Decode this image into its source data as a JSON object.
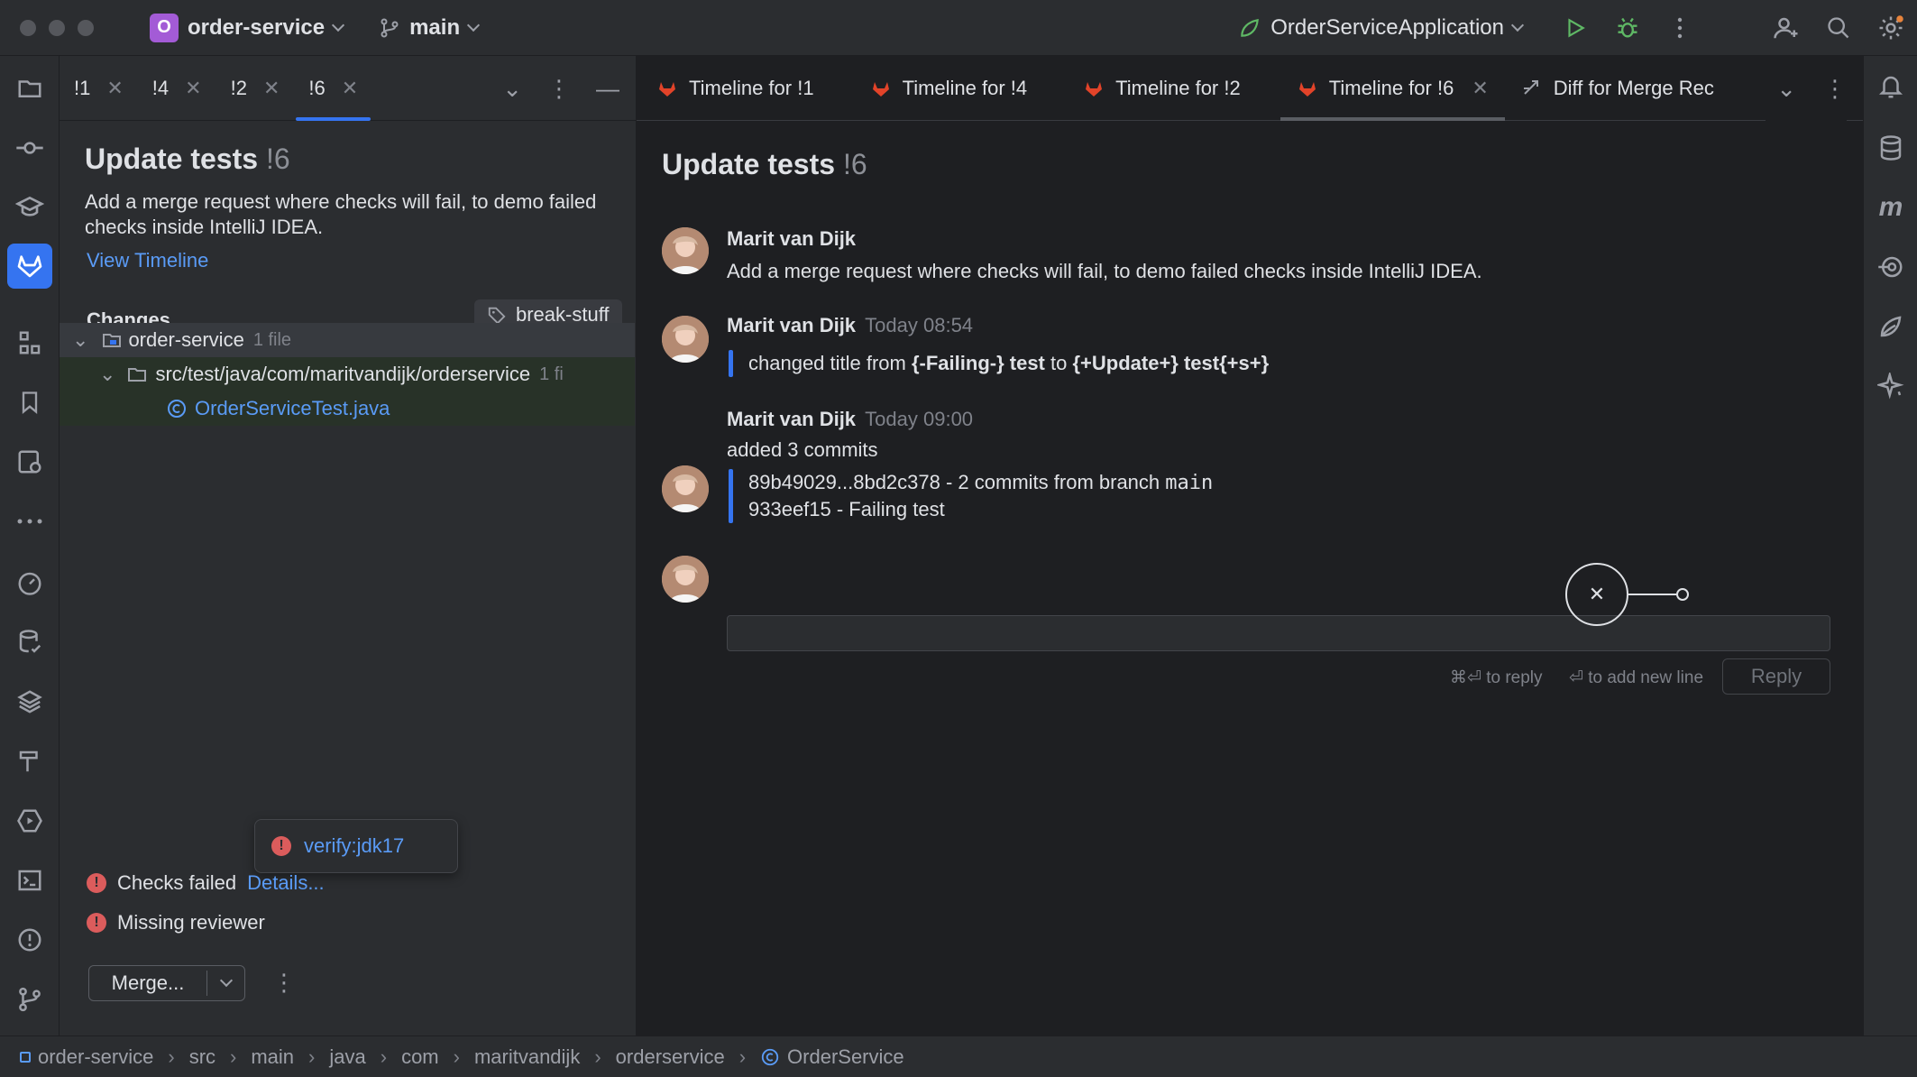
{
  "titlebar": {
    "project_badge": "O",
    "project_name": "order-service",
    "branch": "main",
    "run_config": "OrderServiceApplication"
  },
  "left_panel": {
    "tabs": [
      {
        "label": "!1"
      },
      {
        "label": "!4"
      },
      {
        "label": "!2"
      },
      {
        "label": "!6",
        "active": true
      }
    ],
    "title": "Update tests",
    "title_number": "!6",
    "description": "Add a merge request where checks will fail, to demo failed checks inside IntelliJ IDEA.",
    "view_timeline": "View Timeline",
    "changes_label": "Changes",
    "branch_tag": "break-stuff",
    "tree": {
      "root": "order-service",
      "root_count": "1 file",
      "folder": "src/test/java/com/maritvandijk/orderservice",
      "folder_count": "1 fi",
      "file": "OrderServiceTest.java"
    },
    "popup_check": "verify:jdk17",
    "checks_failed": "Checks failed",
    "details": "Details...",
    "missing_reviewer": "Missing reviewer",
    "merge_button": "Merge..."
  },
  "editor": {
    "tabs": [
      {
        "label": "Timeline for !1"
      },
      {
        "label": "Timeline for !4"
      },
      {
        "label": "Timeline for !2"
      },
      {
        "label": "Timeline for !6",
        "active": true
      },
      {
        "label": "Diff for Merge Rec"
      }
    ],
    "title": "Update tests",
    "title_number": "!6",
    "timeline": [
      {
        "author": "Marit van Dijk",
        "time": "",
        "text": "Add a merge request where checks will fail, to demo failed checks inside IntelliJ IDEA."
      },
      {
        "author": "Marit van Dijk",
        "time": "Today 08:54",
        "prefix": "changed title from ",
        "from": "{-Failing-} test",
        "mid": " to ",
        "to": "{+Update+} test{+s+}"
      },
      {
        "author": "Marit van Dijk",
        "time": "Today 09:00",
        "text": "added 3 commits",
        "commit_range": "89b49029...8bd2c378 - 2 commits from branch ",
        "commit_branch": "main",
        "commit_single": "933eef15 - Failing test"
      }
    ],
    "reply_hint": "⌘⏎ to reply",
    "newline_hint": "⏎ to add new line",
    "reply_button": "Reply"
  },
  "statusbar": {
    "crumbs": [
      "order-service",
      "src",
      "main",
      "java",
      "com",
      "maritvandijk",
      "orderservice",
      "OrderService"
    ]
  },
  "colors": {
    "accent": "#3574f0",
    "link": "#5a9bf6",
    "error": "#db5c5c",
    "gitlab": "#e24329"
  }
}
